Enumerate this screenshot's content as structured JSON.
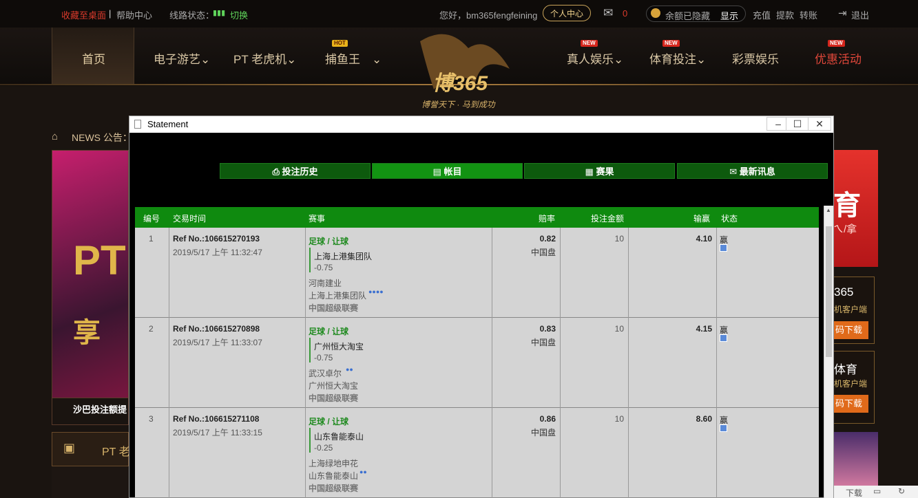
{
  "topbar": {
    "fav": "收藏至桌面",
    "help": "帮助中心",
    "line_label": "线路状态：",
    "switch": "切换",
    "greeting": "您好，bm365fengfeining",
    "center": "个人中心",
    "mail_count": "0",
    "balance_hidden": "余额已隐藏",
    "show": "显示",
    "deposit": "充值",
    "withdraw": "提款",
    "transfer": "转账",
    "logout": "退出"
  },
  "nav": {
    "home": "首页",
    "slots": "电子游艺",
    "pt": "PT 老虎机",
    "fish": "捕鱼王",
    "hot": "HOT",
    "live": "真人娱乐",
    "sports": "体育投注",
    "lottery": "彩票娱乐",
    "promo": "优惠活动",
    "new": "NEW"
  },
  "logo": {
    "main": "博365",
    "slogan": "博誉天下 · 马到成功"
  },
  "bg": {
    "news": "NEWS 公告：",
    "shaba": "沙巴投注额提",
    "pt_left": "PT 老",
    "right_365": "365",
    "right_client": "机客户端",
    "right_dl": "码下载",
    "right_sports": "体育",
    "right_client2": "机客户端",
    "right_dl2": "码下载",
    "right_top": "育",
    "right_top2": "ㄟ/拿",
    "bottom_dl": "下载"
  },
  "dialog": {
    "title": "Statement",
    "tabs": [
      "投注历史",
      "帐目",
      "赛果",
      "最新讯息"
    ],
    "headers": [
      "编号",
      "交易时间",
      "赛事",
      "赔率",
      "投注金额",
      "输赢",
      "状态"
    ],
    "rows": [
      {
        "no": "1",
        "ref": "Ref No.:106615270193",
        "time": "2019/5/17 上午 11:32:47",
        "sport": "足球 / 让球",
        "pick": "上海上港集团队",
        "hdp": "-0.75",
        "home": "河南建业",
        "away": "上海上港集团队",
        "league": "中国超级联赛",
        "odds": "0.82",
        "odds_type": "中国盘",
        "stake": "10",
        "win": "4.10",
        "status": "赢"
      },
      {
        "no": "2",
        "ref": "Ref No.:106615270898",
        "time": "2019/5/17 上午 11:33:07",
        "sport": "足球 / 让球",
        "pick": "广州恒大淘宝",
        "hdp": "-0.75",
        "home": "武汉卓尔",
        "away": "广州恒大淘宝",
        "league": "中国超级联赛",
        "odds": "0.83",
        "odds_type": "中国盘",
        "stake": "10",
        "win": "4.15",
        "status": "赢"
      },
      {
        "no": "3",
        "ref": "Ref No.:106615271108",
        "time": "2019/5/17 上午 11:33:15",
        "sport": "足球 / 让球",
        "pick": "山东鲁能泰山",
        "hdp": "-0.25",
        "home": "上海绿地申花",
        "away": "山东鲁能泰山",
        "league": "中国超级联赛",
        "odds": "0.86",
        "odds_type": "中国盘",
        "stake": "10",
        "win": "8.60",
        "status": "赢"
      }
    ]
  }
}
